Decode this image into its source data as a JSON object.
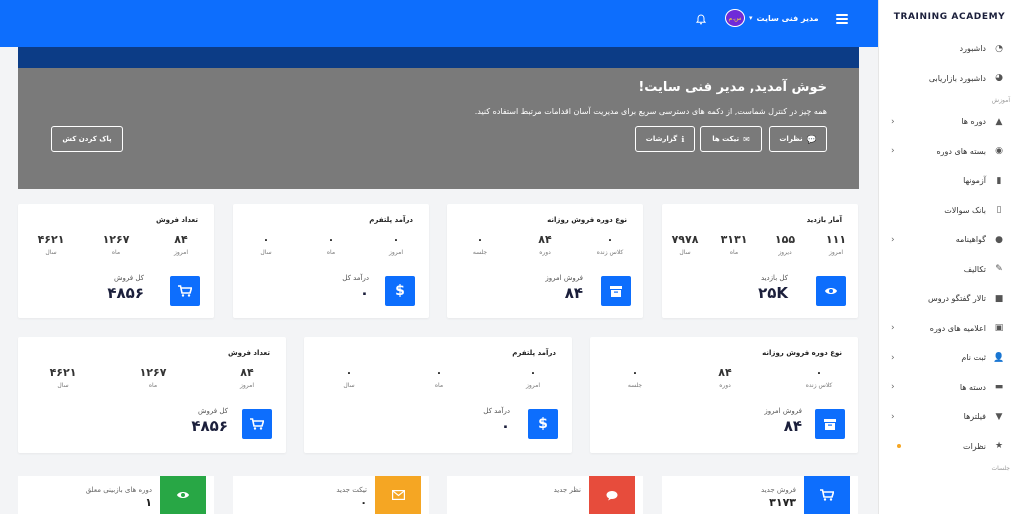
{
  "brand": "TRAINING ACADEMY",
  "sidebar": {
    "items": [
      {
        "label": "داشبورد",
        "icon": "dashboard-icon",
        "chevron": false
      },
      {
        "label": "داشبورد بازاریابی",
        "icon": "marketing-dashboard-icon",
        "chevron": false
      }
    ],
    "section_education": "آموزش",
    "edu_items": [
      {
        "label": "دوره ها",
        "icon": "graduation-cap-icon",
        "chevron": true
      },
      {
        "label": "بسته های دوره",
        "icon": "package-icon",
        "chevron": true
      },
      {
        "label": "آزمونها",
        "icon": "file-icon",
        "chevron": false
      },
      {
        "label": "بانک سوالات",
        "icon": "question-bank-icon",
        "chevron": false
      },
      {
        "label": "گواهینامه",
        "icon": "certificate-icon",
        "chevron": true
      },
      {
        "label": "تکالیف",
        "icon": "pencil-icon",
        "chevron": false
      },
      {
        "label": "تالار گفتگو دروس",
        "icon": "forum-icon",
        "chevron": false
      },
      {
        "label": "اعلامیه های دوره",
        "icon": "clipboard-icon",
        "chevron": true
      },
      {
        "label": "ثبت نام",
        "icon": "user-plus-icon",
        "chevron": true
      },
      {
        "label": "دسته ها",
        "icon": "folder-icon",
        "chevron": true
      },
      {
        "label": "فیلترها",
        "icon": "filter-icon",
        "chevron": true
      },
      {
        "label": "نظرات",
        "icon": "star-icon",
        "chevron": false
      }
    ],
    "section_sessions": "جلسات"
  },
  "topbar": {
    "user_name": "مدیر فنی سایت",
    "avatar_text": "س.م"
  },
  "welcome": {
    "title": "خوش آمدید, مدیر فنی سایت!",
    "subtitle": "همه چیز در کنترل شماست, از دکمه های دسترسی سریع برای مدیریت آسان اقدامات مرتبط استفاده کنید.",
    "btn_comments": "نظرات",
    "btn_tickets": "تیکت ها",
    "btn_reports": "گزارشات",
    "btn_clear_cache": "پاک کردن کش"
  },
  "row1": [
    {
      "title": "آمار بازدید",
      "stats": [
        {
          "v": "۱۱۱",
          "l": "امروز"
        },
        {
          "v": "۱۵۵",
          "l": "دیروز"
        },
        {
          "v": "۳۱۳۱",
          "l": "ماه"
        },
        {
          "v": "۷۹۷۸",
          "l": "سال"
        }
      ],
      "total_label": "کل بازدید",
      "total_value": "۲۵K",
      "icon": "eye-icon"
    },
    {
      "title": "نوع دوره فروش روزانه",
      "stats": [
        {
          "v": "۰",
          "l": "کلاس زنده"
        },
        {
          "v": "۸۴",
          "l": "دوره"
        },
        {
          "v": "۰",
          "l": "جلسه"
        }
      ],
      "total_label": "فروش امروز",
      "total_value": "۸۴",
      "icon": "archive-icon"
    },
    {
      "title": "درآمد پلتفرم",
      "stats": [
        {
          "v": "۰",
          "l": "امروز"
        },
        {
          "v": "۰",
          "l": "ماه"
        },
        {
          "v": "۰",
          "l": "سال"
        }
      ],
      "total_label": "درآمد کل",
      "total_value": "۰",
      "icon": "dollar-icon"
    },
    {
      "title": "تعداد فروش",
      "stats": [
        {
          "v": "۸۴",
          "l": "امروز"
        },
        {
          "v": "۱۲۶۷",
          "l": "ماه"
        },
        {
          "v": "۴۶۲۱",
          "l": "سال"
        }
      ],
      "total_label": "کل فروش",
      "total_value": "۴۸۵۶",
      "icon": "cart-icon"
    }
  ],
  "row2": [
    {
      "title": "نوع دوره فروش روزانه",
      "stats": [
        {
          "v": "۰",
          "l": "کلاس زنده"
        },
        {
          "v": "۸۴",
          "l": "دوره"
        },
        {
          "v": "۰",
          "l": "جلسه"
        }
      ],
      "total_label": "فروش امروز",
      "total_value": "۸۴",
      "icon": "archive-icon"
    },
    {
      "title": "درآمد پلتفرم",
      "stats": [
        {
          "v": "۰",
          "l": "امروز"
        },
        {
          "v": "۰",
          "l": "ماه"
        },
        {
          "v": "۰",
          "l": "سال"
        }
      ],
      "total_label": "درآمد کل",
      "total_value": "۰",
      "icon": "dollar-icon"
    },
    {
      "title": "تعداد فروش",
      "stats": [
        {
          "v": "۸۴",
          "l": "امروز"
        },
        {
          "v": "۱۲۶۷",
          "l": "ماه"
        },
        {
          "v": "۴۶۲۱",
          "l": "سال"
        }
      ],
      "total_label": "کل فروش",
      "total_value": "۴۸۵۶",
      "icon": "cart-icon"
    }
  ],
  "row3": [
    {
      "label": "فروش جدید",
      "value": "۳۱۷۳",
      "color": "#0d6efd",
      "icon": "cart-icon"
    },
    {
      "label": "نظر جدید",
      "value": "",
      "color": "#e74c3c",
      "icon": "comment-icon"
    },
    {
      "label": "تیکت جدید",
      "value": "۰",
      "color": "#f5a623",
      "icon": "envelope-icon"
    },
    {
      "label": "دوره های بازبینی معلق",
      "value": "۱",
      "color": "#28a745",
      "icon": "eye-icon"
    }
  ],
  "colors": {
    "primary": "#0d6efd",
    "navy": "#0c3c86",
    "welcome_bg": "#7a7a7a"
  }
}
